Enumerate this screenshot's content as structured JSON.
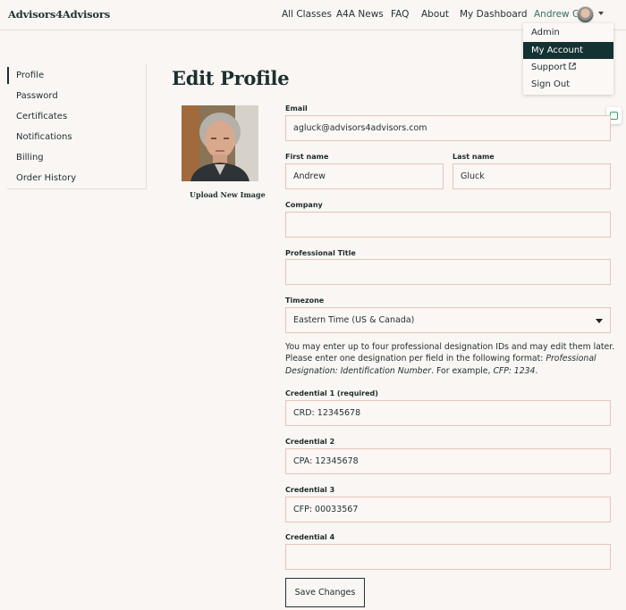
{
  "header": {
    "logo": "Advisors4Advisors",
    "nav": [
      "All Classes",
      "A4A News",
      "FAQ",
      "About",
      "My Dashboard"
    ],
    "user_name": "Andrew G",
    "avatar_icon": "user-avatar",
    "caret_icon": "chevron-down-icon"
  },
  "user_menu": {
    "items": [
      "Admin",
      "My Account",
      "Support",
      "Sign Out"
    ],
    "active": "My Account",
    "support_icon": "external-link-icon"
  },
  "side_widget_icon": "grammar-check-icon",
  "sidebar": {
    "items": [
      "Profile",
      "Password",
      "Certificates",
      "Notifications",
      "Billing",
      "Order History"
    ],
    "active": "Profile"
  },
  "page_title": "Edit Profile",
  "photo": {
    "upload_label": "Upload New Image"
  },
  "form": {
    "email_label": "Email",
    "email_value": "agluck@advisors4advisors.com",
    "first_name_label": "First name",
    "first_name_value": "Andrew",
    "last_name_label": "Last name",
    "last_name_value": "Gluck",
    "company_label": "Company",
    "company_value": "",
    "title_label": "Professional Title",
    "title_value": "",
    "timezone_label": "Timezone",
    "timezone_value": "Eastern Time (US & Canada)",
    "info_line1": "You may enter up to four professional designation IDs and may edit them later.",
    "info_line2a": "Please enter one designation per field in the following format: ",
    "info_italic1": "Professional Designation: Identification Number",
    "info_line2b": ". For example, ",
    "info_italic2": "CFP: 1234",
    "info_end": ".",
    "credentials": [
      {
        "label": "Credential 1 (required)",
        "value": "CRD: 12345678"
      },
      {
        "label": "Credential 2",
        "value": "CPA: 12345678"
      },
      {
        "label": "Credential 3",
        "value": "CFP: 00033567"
      },
      {
        "label": "Credential 4",
        "value": ""
      }
    ],
    "save_label": "Save Changes"
  },
  "colors": {
    "background": "#f9f6f3",
    "dark": "#143231",
    "accent": "#3b6e64",
    "field_border": "#e6c4b6"
  }
}
